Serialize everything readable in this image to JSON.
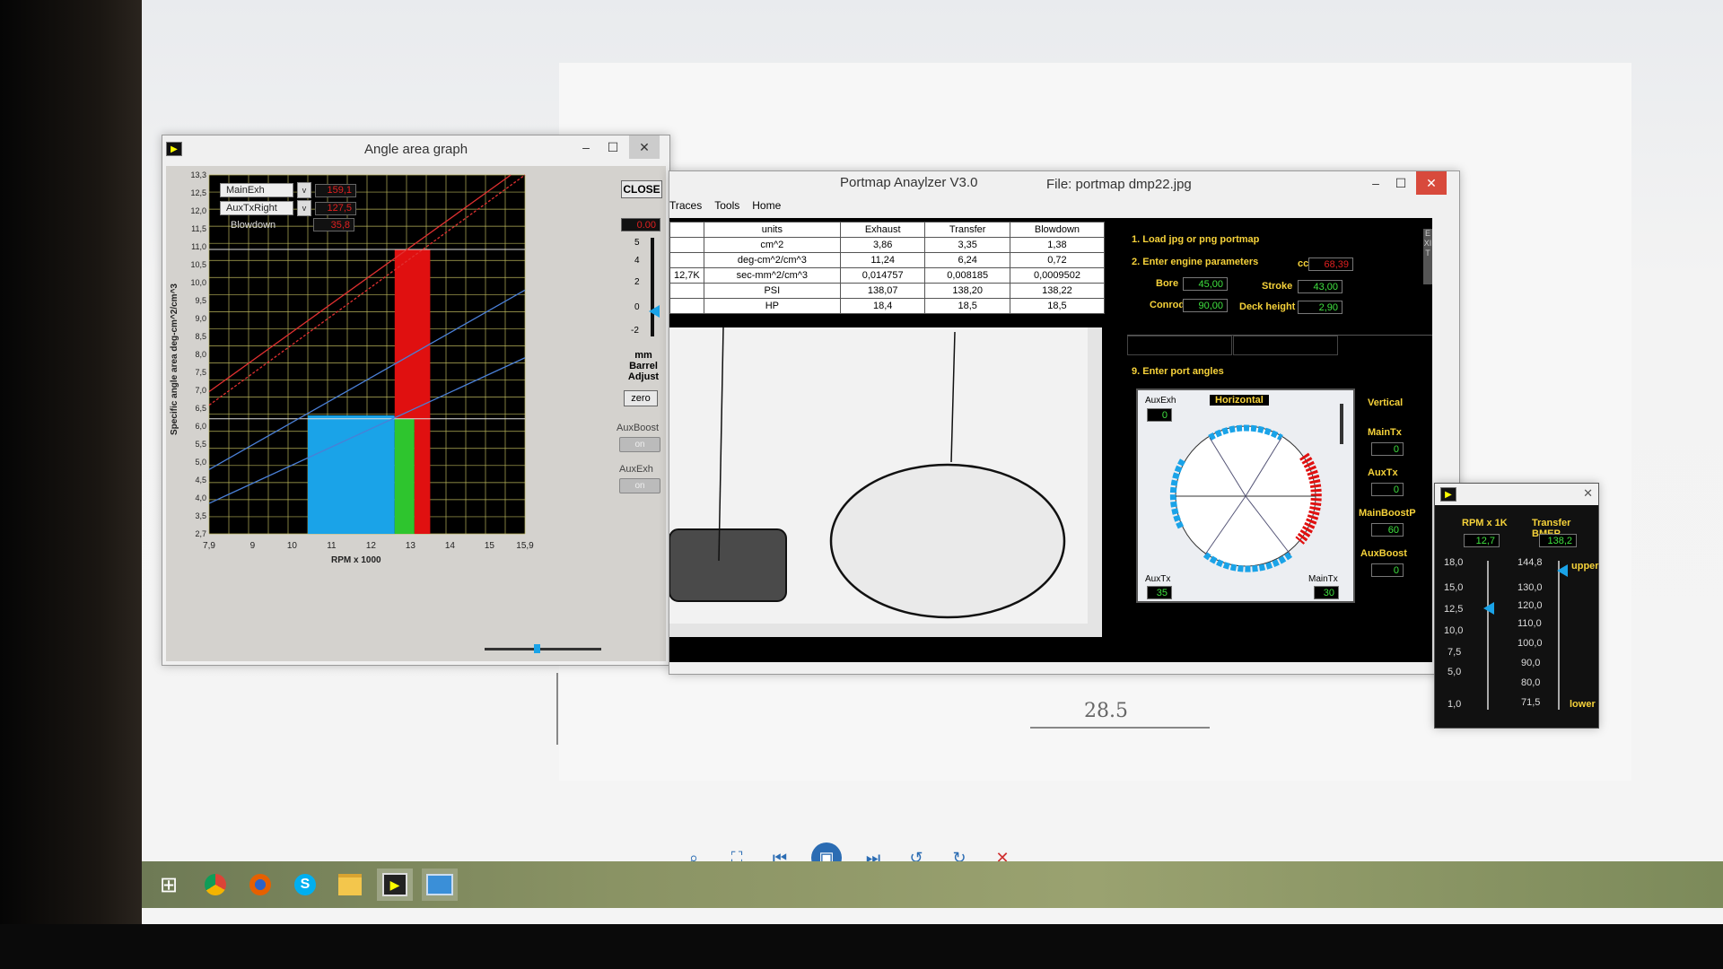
{
  "angle_window": {
    "title": "Angle area graph",
    "minimize": "–",
    "maximize": "☐",
    "close": "✕",
    "selectors": [
      {
        "label": "MainExh",
        "value": "159,1",
        "arrow": "v"
      },
      {
        "label": "AuxTxRight",
        "value": "127,5",
        "arrow": "v"
      },
      {
        "label": "Blowdown",
        "value": "35,8"
      }
    ],
    "close_button": "CLOSE",
    "barrel_value": "0.00",
    "barrel_ticks": [
      "5",
      "4",
      "2",
      "0",
      "-2"
    ],
    "barrel_label_1": "mm",
    "barrel_label_2": "Barrel",
    "barrel_label_3": "Adjust",
    "zero_button": "zero",
    "auxboost_label": "AuxBoost",
    "auxboost_toggle": "on",
    "auxexh_label": "AuxExh",
    "auxexh_toggle": "on"
  },
  "chart_data": {
    "type": "bar",
    "xlabel": "RPM x 1000",
    "ylabel": "Specific angle area  deg-cm^2/cm^3",
    "xlim": [
      7.9,
      15.9
    ],
    "ylim": [
      2.7,
      13.3
    ],
    "x_ticks": [
      "7,9",
      "9",
      "10",
      "11",
      "12",
      "13",
      "14",
      "15",
      "15,9"
    ],
    "y_ticks": [
      "13,3",
      "12,5",
      "12,0",
      "11,5",
      "11,0",
      "10,5",
      "10,0",
      "9,5",
      "9,0",
      "8,5",
      "8,0",
      "7,5",
      "7,0",
      "6,5",
      "6,0",
      "5,5",
      "5,0",
      "4,5",
      "4,0",
      "3,5",
      "2,7"
    ],
    "bars": [
      {
        "x0": 10.4,
        "x1": 12.6,
        "y0": 2.7,
        "y1": 6.2,
        "color": "#1aa3e8"
      },
      {
        "x0": 12.6,
        "x1": 13.1,
        "y0": 2.7,
        "y1": 6.1,
        "color": "#2ec52e"
      },
      {
        "x0": 12.6,
        "x1": 13.5,
        "y0": 6.1,
        "y1": 11.1,
        "color": "#e01010"
      },
      {
        "x0": 13.1,
        "x1": 13.5,
        "y0": 2.7,
        "y1": 6.1,
        "color": "#e01010"
      }
    ],
    "lines": [
      {
        "color": "#e03030",
        "dash": true,
        "x": [
          7.9,
          15.9
        ],
        "y": [
          6.5,
          13.3
        ]
      },
      {
        "color": "#e03030",
        "dash": false,
        "x": [
          7.9,
          15.9
        ],
        "y": [
          6.9,
          13.6
        ]
      },
      {
        "color": "#4a7fd6",
        "dash": false,
        "x": [
          7.9,
          15.9
        ],
        "y": [
          3.6,
          7.9
        ]
      },
      {
        "color": "#4a7fd6",
        "dash": false,
        "x": [
          7.9,
          15.9
        ],
        "y": [
          4.6,
          9.9
        ]
      }
    ],
    "hlines": [
      {
        "y": 11.1,
        "color": "#dddddd"
      },
      {
        "y": 6.1,
        "color": "#dddddd"
      }
    ]
  },
  "portmap": {
    "title": "Portmap Anaylzer V3.0",
    "file": "File: portmap dmp22.jpg",
    "menu": [
      "Traces",
      "Tools",
      "Home"
    ],
    "table": {
      "columns": [
        "units",
        "Exhaust",
        "Transfer",
        "Blowdown"
      ],
      "left_col": [
        "",
        "",
        "12,7K",
        "",
        ""
      ],
      "rows": [
        [
          "cm^2",
          "3,86",
          "3,35",
          "1,38"
        ],
        [
          "deg-cm^2/cm^3",
          "11,24",
          "6,24",
          "0,72"
        ],
        [
          "sec-mm^2/cm^3",
          "0,014757",
          "0,008185",
          "0,0009502"
        ],
        [
          "PSI",
          "138,07",
          "138,20",
          "138,22"
        ],
        [
          "HP",
          "18,4",
          "18,5",
          "18,5"
        ]
      ]
    },
    "step1": "1. Load jpg or png portmap",
    "step2": "2. Enter engine parameters",
    "cc_label": "cc",
    "cc_value": "68,39",
    "bore_label": "Bore",
    "bore_value": "45,00",
    "stroke_label": "Stroke",
    "stroke_value": "43,00",
    "conrod_label": "Conrod",
    "conrod_value": "90,00",
    "deck_label": "Deck height",
    "deck_value": "2,90",
    "exit_label": "EXIT",
    "step9": "9. Enter port angles",
    "auxexh_label": "AuxExh",
    "auxexh_value": "0",
    "horizontal_label": "Horizontal",
    "vertical_label": "Vertical",
    "maintx_label": "MainTx",
    "maintx_value": "0",
    "auxtx_label": "AuxTx",
    "auxtx_value": "0",
    "mainboost_label": "MainBoostP",
    "mainboost_value": "60",
    "auxboost_label": "AuxBoost",
    "auxboost_value": "0",
    "dial_auxtx_label": "AuxTx",
    "dial_auxtx_value": "35",
    "dial_maintx_label": "MainTx",
    "dial_maintx_value": "30"
  },
  "rpm_window": {
    "rpm_label": "RPM x 1K",
    "rpm_value": "12,7",
    "bmep_label": "Transfer BMEP",
    "bmep_value": "138,2",
    "rpm_ticks": [
      "18,0",
      "15,0",
      "12,5",
      "10,0",
      "7,5",
      "5,0",
      "1,0"
    ],
    "bmep_ticks": [
      "144,8",
      "130,0",
      "120,0",
      "110,0",
      "100,0",
      "90,0",
      "80,0",
      "71,5"
    ],
    "upper_label": "upper",
    "lower_label": "lower",
    "close": "✕"
  },
  "paper_note": "28.5",
  "colors": {
    "accent_red": "#e01010",
    "accent_blue": "#1aa3e8",
    "accent_green": "#2ec52e",
    "label_yellow": "#f6d23a"
  }
}
